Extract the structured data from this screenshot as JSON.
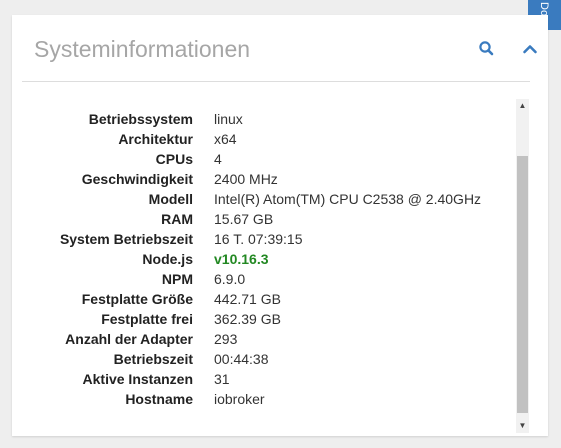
{
  "side_tab": {
    "label": "Do"
  },
  "card": {
    "title": "Systeminformationen"
  },
  "info": [
    {
      "key": "Betriebssystem",
      "value": "linux"
    },
    {
      "key": "Architektur",
      "value": "x64"
    },
    {
      "key": "CPUs",
      "value": "4"
    },
    {
      "key": "Geschwindigkeit",
      "value": "2400 MHz"
    },
    {
      "key": "Modell",
      "value": "Intel(R) Atom(TM) CPU C2538 @ 2.40GHz"
    },
    {
      "key": "RAM",
      "value": "15.67 GB"
    },
    {
      "key": "System Betriebszeit",
      "value": "16 T. 07:39:15"
    },
    {
      "key": "Node.js",
      "value": "v10.16.3"
    },
    {
      "key": "NPM",
      "value": "6.9.0"
    },
    {
      "key": "Festplatte Größe",
      "value": "442.71 GB"
    },
    {
      "key": "Festplatte frei",
      "value": "362.39 GB"
    },
    {
      "key": "Anzahl der Adapter",
      "value": "293"
    },
    {
      "key": "Betriebszeit",
      "value": "00:44:38"
    },
    {
      "key": "Aktive Instanzen",
      "value": "31"
    },
    {
      "key": "Hostname",
      "value": "iobroker"
    }
  ],
  "colors": {
    "accent": "#3a7bbf",
    "highlight_value": "#228822",
    "title": "#a6a6a6"
  },
  "icons": {
    "search": "search-icon",
    "collapse": "chevron-up-icon"
  }
}
